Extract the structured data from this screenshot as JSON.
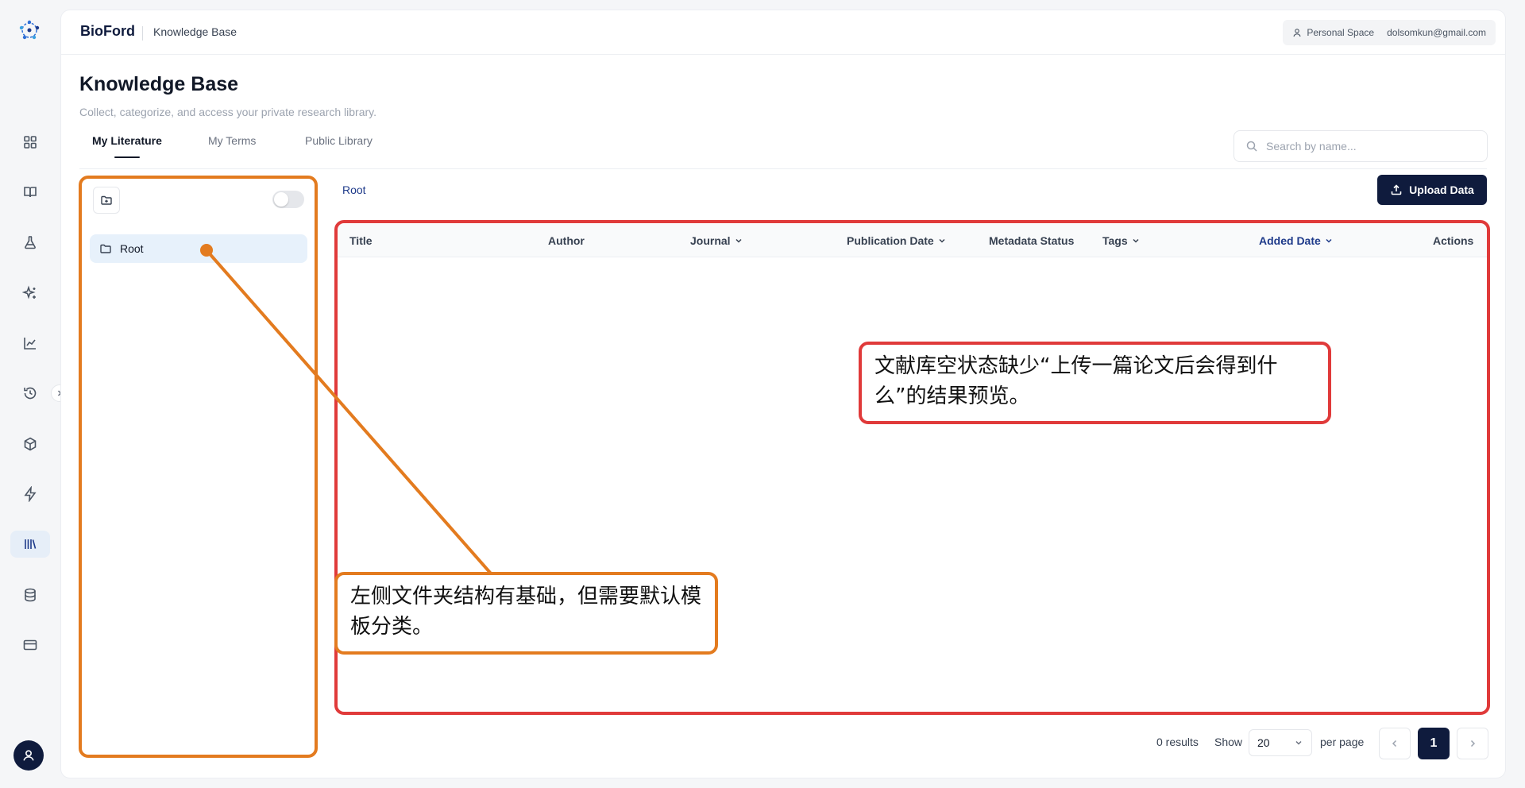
{
  "app": {
    "brand": "BioFord",
    "section": "Knowledge Base",
    "workspace_label": "Personal Space",
    "user_email": "dolsomkun@gmail.com"
  },
  "rail": {
    "items": [
      {
        "icon": "grid-icon"
      },
      {
        "icon": "book-icon"
      },
      {
        "icon": "flask-icon"
      },
      {
        "icon": "sparkles-icon"
      },
      {
        "icon": "chart-line-icon"
      },
      {
        "icon": "history-icon"
      },
      {
        "icon": "cube-icon"
      },
      {
        "icon": "bolt-icon"
      },
      {
        "icon": "library-icon",
        "active": true
      },
      {
        "icon": "database-icon"
      },
      {
        "icon": "credit-card-icon"
      }
    ]
  },
  "page": {
    "title": "Knowledge Base",
    "description": "Collect, categorize, and access your private research library."
  },
  "tabs": [
    {
      "label": "My Literature",
      "active": true
    },
    {
      "label": "My Terms",
      "active": false
    },
    {
      "label": "Public Library",
      "active": false
    }
  ],
  "search": {
    "placeholder": "Search by name...",
    "value": ""
  },
  "folders": {
    "items": [
      {
        "label": "Root",
        "selected": true
      }
    ]
  },
  "breadcrumb": "Root",
  "upload_label": "Upload Data",
  "table": {
    "columns": [
      {
        "label": "Title",
        "sortable": false
      },
      {
        "label": "Author",
        "sortable": false
      },
      {
        "label": "Journal",
        "sortable": true
      },
      {
        "label": "Publication Date",
        "sortable": true
      },
      {
        "label": "Metadata Status",
        "sortable": false
      },
      {
        "label": "Tags",
        "sortable": true
      },
      {
        "label": "Added Date",
        "sortable": true,
        "sorted": true
      },
      {
        "label": "Actions",
        "sortable": false
      }
    ],
    "rows": []
  },
  "pagination": {
    "results_text": "0 results",
    "show_label": "Show",
    "per_page_value": "20",
    "per_page_label": "per page",
    "current_page": "1"
  },
  "annotations": {
    "folder_note": "左侧文件夹结构有基础，但需要默认模板分类。",
    "empty_state_note": "文献库空状态缺少“上传一篇论文后会得到什么”的结果预览。",
    "colors": {
      "orange": "#e37b1f",
      "red": "#e03a3a"
    }
  }
}
